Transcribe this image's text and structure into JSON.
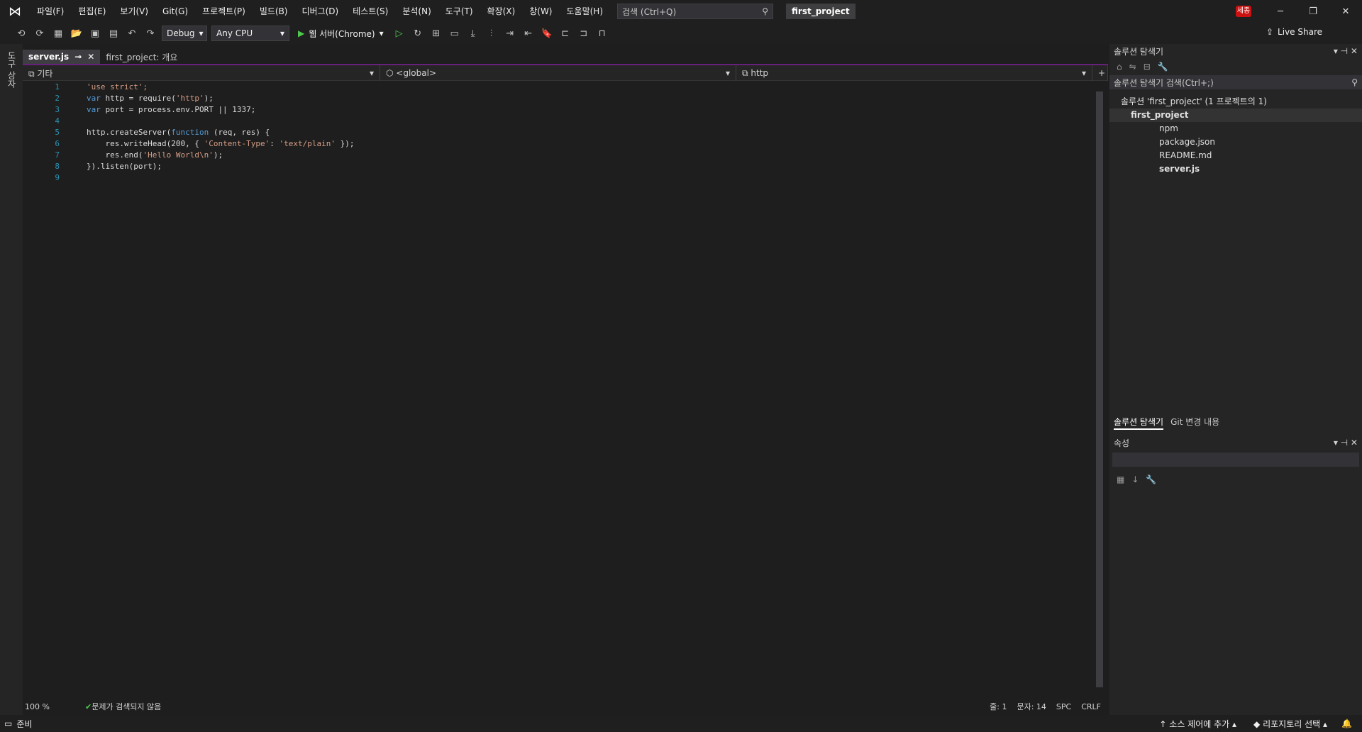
{
  "menu": [
    "파일(F)",
    "편집(E)",
    "보기(V)",
    "Git(G)",
    "프로젝트(P)",
    "빌드(B)",
    "디버그(D)",
    "테스트(S)",
    "분석(N)",
    "도구(T)",
    "확장(X)",
    "창(W)",
    "도움말(H)"
  ],
  "search_placeholder": "검색 (Ctrl+Q)",
  "project_title": "first_project",
  "user_badge": "세종",
  "toolbar": {
    "config": "Debug",
    "platform": "Any CPU",
    "run_label": "웹 서버(Chrome)",
    "live_share": "Live Share"
  },
  "left_tab": "도구 상자",
  "tabs": [
    {
      "label": "server.js",
      "active": true
    },
    {
      "label": "first_project: 개요",
      "active": false
    }
  ],
  "navbar": {
    "scope": "기타",
    "context": "<global>",
    "member": "http"
  },
  "code_lines": [
    [
      {
        "t": "'use strict';",
        "c": "str"
      }
    ],
    [
      {
        "t": "var",
        "c": "kw"
      },
      {
        "t": " http = require("
      },
      {
        "t": "'http'",
        "c": "str"
      },
      {
        "t": ");"
      }
    ],
    [
      {
        "t": "var",
        "c": "kw"
      },
      {
        "t": " port = process.env.PORT || 1337;"
      }
    ],
    [],
    [
      {
        "t": "http.createServer("
      },
      {
        "t": "function",
        "c": "kw"
      },
      {
        "t": " (req, res) {"
      }
    ],
    [
      {
        "t": "    res.writeHead(200, { "
      },
      {
        "t": "'Content-Type'",
        "c": "str"
      },
      {
        "t": ": "
      },
      {
        "t": "'text/plain'",
        "c": "str"
      },
      {
        "t": " });"
      }
    ],
    [
      {
        "t": "    res.end("
      },
      {
        "t": "'Hello World\\n'",
        "c": "str"
      },
      {
        "t": ");"
      }
    ],
    [
      {
        "t": "}).listen(port);"
      }
    ],
    []
  ],
  "editor_status": {
    "zoom": "100 %",
    "issues": "문제가 검색되지 않음",
    "line": "줄: 1",
    "col": "문자: 14",
    "spc": "SPC",
    "crlf": "CRLF"
  },
  "solution_explorer": {
    "title": "솔루션 탐색기",
    "search": "솔루션 탐색기 검색(Ctrl+;)",
    "solution": "솔루션 'first_project' (1 프로젝트의 1)",
    "project": "first_project",
    "items": [
      "npm",
      "package.json",
      "README.md",
      "server.js"
    ],
    "tabs": [
      "솔루션 탐색기",
      "Git 변경 내용"
    ]
  },
  "properties": {
    "title": "속성"
  },
  "statusbar": {
    "ready": "준비",
    "source_control": "소스 제어에 추가",
    "repo": "리포지토리 선택"
  }
}
